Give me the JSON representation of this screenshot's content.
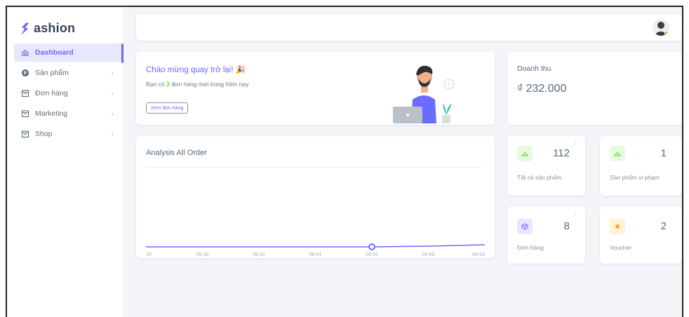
{
  "brand": {
    "name": "ashion",
    "logo_color": "#696cff"
  },
  "sidebar": {
    "items": [
      {
        "label": "Dashboard",
        "icon": "home-icon",
        "active": true
      },
      {
        "label": "Sản phẩm",
        "icon": "product-icon",
        "chevron": "›"
      },
      {
        "label": "Đơn hàng",
        "icon": "box-icon",
        "chevron": "›"
      },
      {
        "label": "Marketing",
        "icon": "box-icon",
        "chevron": "›"
      },
      {
        "label": "Shop",
        "icon": "box-icon",
        "chevron": "›"
      }
    ]
  },
  "navbar": {
    "avatar": "user-avatar-icon"
  },
  "welcome": {
    "title": "Chào mừng quay trở lại! 🎉",
    "sub_prefix": "Bạn có ",
    "sub_count": "3",
    "sub_suffix": " đơn hàng mới trong hôm nay.",
    "button": "Xem đơn hàng"
  },
  "revenue": {
    "label": "Doanh thu",
    "value": "₫ 232.000"
  },
  "chart": {
    "title": "Analysis All Order"
  },
  "chart_data": {
    "type": "line",
    "title": "Analysis All Order",
    "categories": [
      "29",
      "08-30",
      "08-31",
      "09-01",
      "09-02",
      "09-03",
      "09-04"
    ],
    "values": [
      0,
      0,
      0,
      0,
      0,
      0.1,
      0.3
    ],
    "highlight_index": 4,
    "color": "#696cff"
  },
  "stats": [
    {
      "value": "112",
      "label": "Tất cả sản phẩm",
      "icon": "hanger-icon",
      "icon_bg": "#e8fadf",
      "icon_color": "#71dd37",
      "menu": "⋮"
    },
    {
      "value": "1",
      "label": "Sản phẩm vi phạm",
      "icon": "hanger-icon",
      "icon_bg": "#e8fadf",
      "icon_color": "#71dd37"
    },
    {
      "value": "8",
      "label": "Đơn hàng",
      "icon": "cube-icon",
      "icon_bg": "#e7e7ff",
      "icon_color": "#696cff",
      "menu": "⋮"
    },
    {
      "value": "2",
      "label": "Voucher",
      "icon": "ticket-icon",
      "icon_bg": "#fff2d6",
      "icon_color": "#ffab00"
    }
  ],
  "colors": {
    "primary": "#696cff",
    "success": "#71dd37",
    "warning": "#ffab00"
  }
}
